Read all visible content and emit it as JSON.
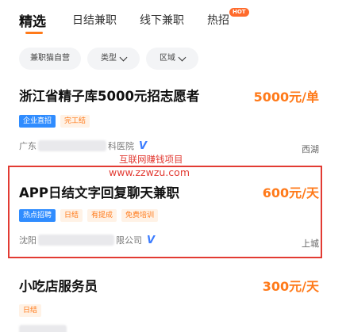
{
  "tabs": [
    {
      "label": "精选",
      "active": true
    },
    {
      "label": "日结兼职",
      "active": false
    },
    {
      "label": "线下兼职",
      "active": false
    },
    {
      "label": "热招",
      "active": false,
      "badge": "HOT"
    }
  ],
  "filters": [
    {
      "label": "兼职猫自营",
      "dropdown": false
    },
    {
      "label": "类型",
      "dropdown": true
    },
    {
      "label": "区域",
      "dropdown": true
    }
  ],
  "jobs": [
    {
      "title": "浙江省精子库5000元招志愿者",
      "salary": "5000元/单",
      "tags": [
        {
          "label": "企业直招",
          "style": "blue"
        },
        {
          "label": "完工结",
          "style": "orange"
        }
      ],
      "company_prefix": "广东",
      "company_suffix": "科医院",
      "district": "西湖"
    },
    {
      "title": "APP日结文字回复聊天兼职",
      "salary": "600元/天",
      "tags": [
        {
          "label": "热点招聘",
          "style": "blue"
        },
        {
          "label": "日结",
          "style": "orange"
        },
        {
          "label": "有提成",
          "style": "orange"
        },
        {
          "label": "免费培训",
          "style": "orange"
        }
      ],
      "company_prefix": "沈阳",
      "company_suffix": "限公司",
      "district": "上城"
    },
    {
      "title": "小吃店服务员",
      "salary": "300元/天",
      "tags": [
        {
          "label": "日结",
          "style": "orange"
        }
      ]
    }
  ],
  "watermark": {
    "line1": "互联网赚钱项目",
    "line2": "www.zzwzu.com"
  },
  "colors": {
    "accent": "#ff7a1a",
    "blue_tag": "#2f8cff",
    "highlight": "#e23b33"
  }
}
